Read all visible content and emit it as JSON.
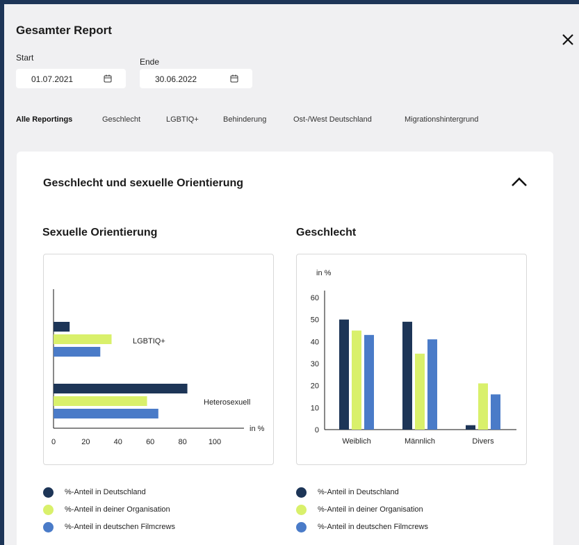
{
  "header": {
    "title": "Gesamter Report"
  },
  "dates": {
    "start_label": "Start",
    "start_value": "01.07.2021",
    "end_label": "Ende",
    "end_value": "30.06.2022"
  },
  "tabs": [
    {
      "label": "Alle Reportings",
      "active": true
    },
    {
      "label": "Geschlecht"
    },
    {
      "label": "LGBTIQ+"
    },
    {
      "label": "Behinderung"
    },
    {
      "label": "Ost-/West Deutschland"
    },
    {
      "label": "Migrationshintergrund"
    }
  ],
  "section": {
    "title": "Geschlecht und sexuelle Orientierung"
  },
  "colors": {
    "deutschland": "#1d3557",
    "organisation": "#d9f06b",
    "filmcrews": "#4a7bc8",
    "axis": "#111111"
  },
  "legend_labels": [
    "%-Anteil in Deutschland",
    "%-Anteil in deiner Organisation",
    "%-Anteil in deutschen Filmcrews"
  ],
  "chart_data": [
    {
      "type": "bar",
      "orientation": "horizontal",
      "title": "Sexuelle Orientierung",
      "categories": [
        "LGBTIQ+",
        "Heterosexuell"
      ],
      "series": [
        {
          "name": "%-Anteil in Deutschland",
          "values": [
            10,
            83
          ]
        },
        {
          "name": "%-Anteil in deiner Organisation",
          "values": [
            36,
            58
          ]
        },
        {
          "name": "%-Anteil in deutschen Filmcrews",
          "values": [
            29,
            65
          ]
        }
      ],
      "xlabel": "in %",
      "xlim": [
        0,
        100
      ],
      "xticks": [
        0,
        20,
        40,
        60,
        80,
        100
      ],
      "legend": "bottom"
    },
    {
      "type": "bar",
      "orientation": "vertical",
      "title": "Geschlecht",
      "categories": [
        "Weiblich",
        "Männlich",
        "Divers"
      ],
      "series": [
        {
          "name": "%-Anteil in Deutschland",
          "values": [
            50,
            49,
            2
          ]
        },
        {
          "name": "%-Anteil in deiner Organisation",
          "values": [
            45,
            34.5,
            21
          ]
        },
        {
          "name": "%-Anteil in deutschen Filmcrews",
          "values": [
            43,
            41,
            16
          ]
        }
      ],
      "ylabel": "in %",
      "ylim": [
        0,
        60
      ],
      "yticks": [
        0,
        10,
        20,
        30,
        40,
        50,
        60
      ],
      "legend": "bottom"
    }
  ]
}
